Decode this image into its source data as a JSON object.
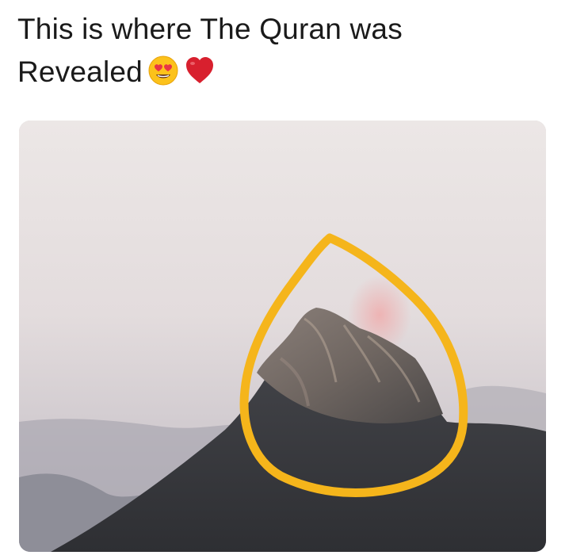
{
  "post": {
    "caption_line1": "This is where The Quran was",
    "caption_line2": "Revealed",
    "emojis": [
      "heart-eyes-emoji",
      "red-heart-emoji"
    ]
  },
  "photo": {
    "subject": "mountain-peak",
    "annotation": "hand-drawn-yellow-circle",
    "colors": {
      "sky_top": "#e9e4e5",
      "sky_bottom": "#c9c3c9",
      "highlight_circle": "#f5b51b",
      "rock": "#6b6765",
      "foreground_mountain": "#3b3c40"
    }
  }
}
